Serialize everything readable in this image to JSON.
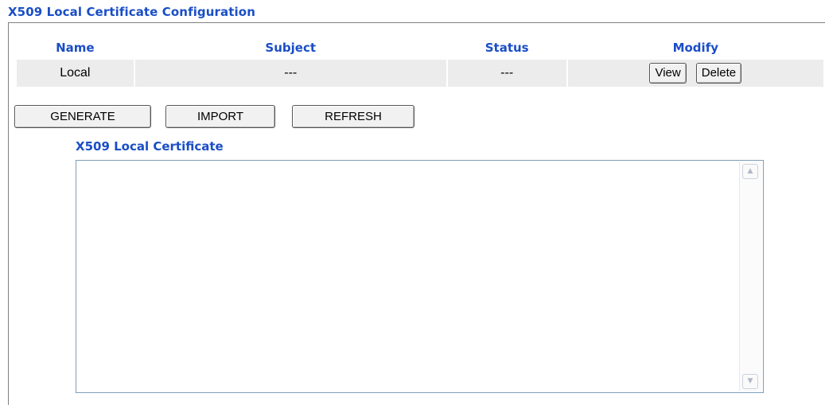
{
  "page": {
    "title": "X509 Local Certificate Configuration",
    "subtitle": "X509 Local Certificate"
  },
  "table": {
    "headers": {
      "name": "Name",
      "subject": "Subject",
      "status": "Status",
      "modify": "Modify"
    },
    "rows": [
      {
        "name": "Local",
        "subject": "---",
        "status": "---",
        "view_label": "View",
        "delete_label": "Delete"
      }
    ]
  },
  "actions": {
    "generate": "GENERATE",
    "import": "IMPORT",
    "refresh": "REFRESH"
  },
  "certificate_text": {
    "value": ""
  },
  "icons": {
    "scroll_up": "chevron-up-icon",
    "scroll_down": "chevron-down-icon"
  },
  "colors": {
    "heading": "#1a4ec6",
    "row_bg": "#ececec",
    "textarea_border": "#7f9db9"
  }
}
